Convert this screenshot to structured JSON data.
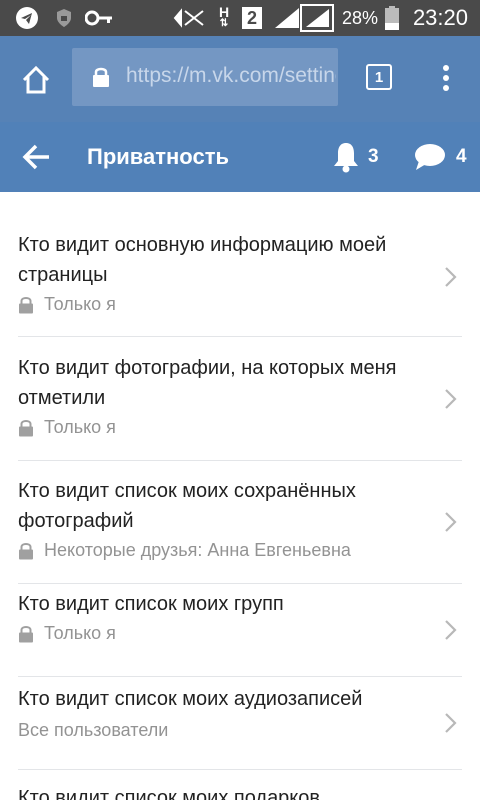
{
  "status_bar": {
    "battery_percent": "28%",
    "time": "23:20",
    "network_letter": "H",
    "sim_number": "2",
    "icons": [
      "telegram-icon",
      "shield-icon",
      "key-icon",
      "mute-icon",
      "network-h-icon",
      "sim-2-icon",
      "signal-icon",
      "signal-icon",
      "battery-icon"
    ]
  },
  "browser": {
    "url": "https://m.vk.com/settings",
    "tab_count": "1",
    "icons": [
      "home-icon",
      "lock-icon",
      "menu-dots-icon"
    ]
  },
  "vk_header": {
    "title": "Приватность",
    "notifications_count": "3",
    "messages_count": "4",
    "accent_color": "#5181b8"
  },
  "privacy_items": [
    {
      "title": "Кто видит основную информацию моей страницы",
      "value": "Только я",
      "locked": true
    },
    {
      "title": "Кто видит фотографии, на которых меня отметили",
      "value": "Только я",
      "locked": true
    },
    {
      "title": "Кто видит список моих сохранённых фотографий",
      "value": "Некоторые друзья: Анна Евгеньевна",
      "locked": true
    },
    {
      "title": "Кто видит список моих групп",
      "value": "Только я",
      "locked": true
    },
    {
      "title": "Кто видит список моих аудиозаписей",
      "value": "Все пользователи",
      "locked": false
    },
    {
      "title": "Кто видит список моих подарков",
      "value": "",
      "locked": false
    }
  ]
}
